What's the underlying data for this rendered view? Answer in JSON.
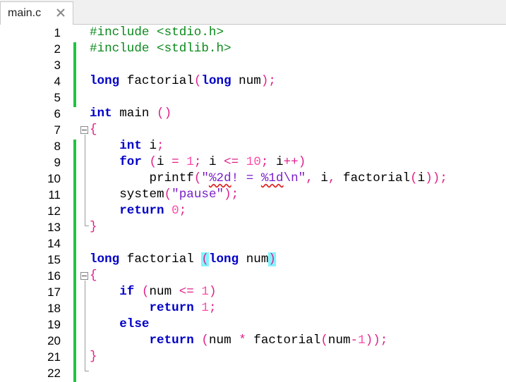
{
  "tab": {
    "label": "main.c",
    "close_glyph": "✕"
  },
  "line_numbers": [
    "1",
    "2",
    "3",
    "4",
    "5",
    "6",
    "7",
    "8",
    "9",
    "10",
    "11",
    "12",
    "13",
    "14",
    "15",
    "16",
    "17",
    "18",
    "19",
    "20",
    "21",
    "22"
  ],
  "code": {
    "l1": {
      "a": "#include <stdio.h>"
    },
    "l2": {
      "a": "#include <stdlib.h>"
    },
    "l4": {
      "kw1": "long",
      "fn": " factorial",
      "p1": "(",
      "kw2": "long",
      "arg": " num",
      "p2": ");"
    },
    "l6": {
      "kw": "int",
      "fn": " main ",
      "p": "()"
    },
    "l7": {
      "b": "{"
    },
    "l8": {
      "kw": "int",
      "v": " i",
      "p": ";"
    },
    "l9": {
      "kw": "for",
      "sp": " ",
      "p1": "(",
      "a": "i ",
      "o1": "=",
      "sp2": " ",
      "n1": "1",
      "o2": ";",
      "b": " i ",
      "o3": "<=",
      "sp3": " ",
      "n2": "10",
      "o4": ";",
      "c": " i",
      "o5": "++)"
    },
    "l10": {
      "fn": "printf",
      "p1": "(",
      "s1": "\"",
      "s2": "%2d",
      "s3": "! = ",
      "s4": "%1d",
      "s5": "\\n\"",
      "o1": ",",
      "a": " i",
      "o2": ",",
      "b": " factorial",
      "p2": "(",
      "c": "i",
      "p3": "));"
    },
    "l11": {
      "fn": "system",
      "p1": "(",
      "s": "\"pause\"",
      "p2": ");"
    },
    "l12": {
      "kw": "return",
      "sp": " ",
      "n": "0",
      "p": ";"
    },
    "l13": {
      "b": "}"
    },
    "l15": {
      "kw1": "long",
      "fn": " factorial ",
      "p1": "(",
      "kw2": "long",
      "arg": " num",
      "p2": ")"
    },
    "l16": {
      "b": "{"
    },
    "l17": {
      "kw": "if",
      "sp": " ",
      "p1": "(",
      "a": "num ",
      "o": "<=",
      "sp2": " ",
      "n": "1",
      "p2": ")"
    },
    "l18": {
      "kw": "return",
      "sp": " ",
      "n": "1",
      "p": ";"
    },
    "l19": {
      "kw": "else"
    },
    "l20": {
      "kw": "return",
      "sp": " ",
      "p1": "(",
      "a": "num ",
      "o": "*",
      "b": " factorial",
      "p2": "(",
      "c": "num",
      "o2": "-",
      "n": "1",
      "p3": "));"
    },
    "l21": {
      "b": "}"
    }
  },
  "colors": {
    "preprocessor": "#0b8a1c",
    "keyword": "#0000c8",
    "operator": "#e0208a",
    "string": "#7a1ec8",
    "number": "#ff4aa8",
    "brace_highlight": "#82f4ff",
    "change_marker": "#21c443"
  }
}
